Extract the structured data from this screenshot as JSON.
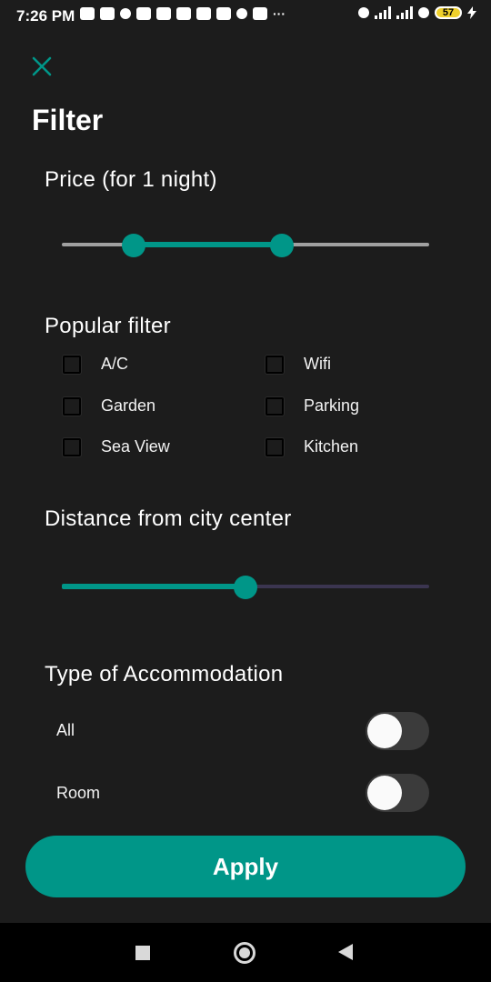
{
  "status_bar": {
    "time": "7:26 PM",
    "battery": "57"
  },
  "header": {
    "close_icon": "close-icon",
    "title": "Filter"
  },
  "price": {
    "title": "Price (for 1 night)",
    "range_low_fraction": 0.195,
    "range_high_fraction": 0.6,
    "accent": "#009688",
    "inactive_track": "#a0a0a0"
  },
  "popular_filter": {
    "title": "Popular filter",
    "options": [
      {
        "label": "A/C",
        "checked": false
      },
      {
        "label": "Wifi",
        "checked": false
      },
      {
        "label": "Garden",
        "checked": false
      },
      {
        "label": "Parking",
        "checked": false
      },
      {
        "label": "Sea View",
        "checked": false
      },
      {
        "label": "Kitchen",
        "checked": false
      }
    ]
  },
  "distance": {
    "title": "Distance from city center",
    "value_fraction": 0.5,
    "inactive_track": "#3b3550"
  },
  "accommodation": {
    "title": "Type of Accommodation",
    "items": [
      {
        "label": "All",
        "on": false
      },
      {
        "label": "Room",
        "on": false
      }
    ]
  },
  "apply_label": "Apply",
  "nav_bar": {
    "icons": [
      "recent-apps-icon",
      "home-icon",
      "back-icon"
    ]
  }
}
